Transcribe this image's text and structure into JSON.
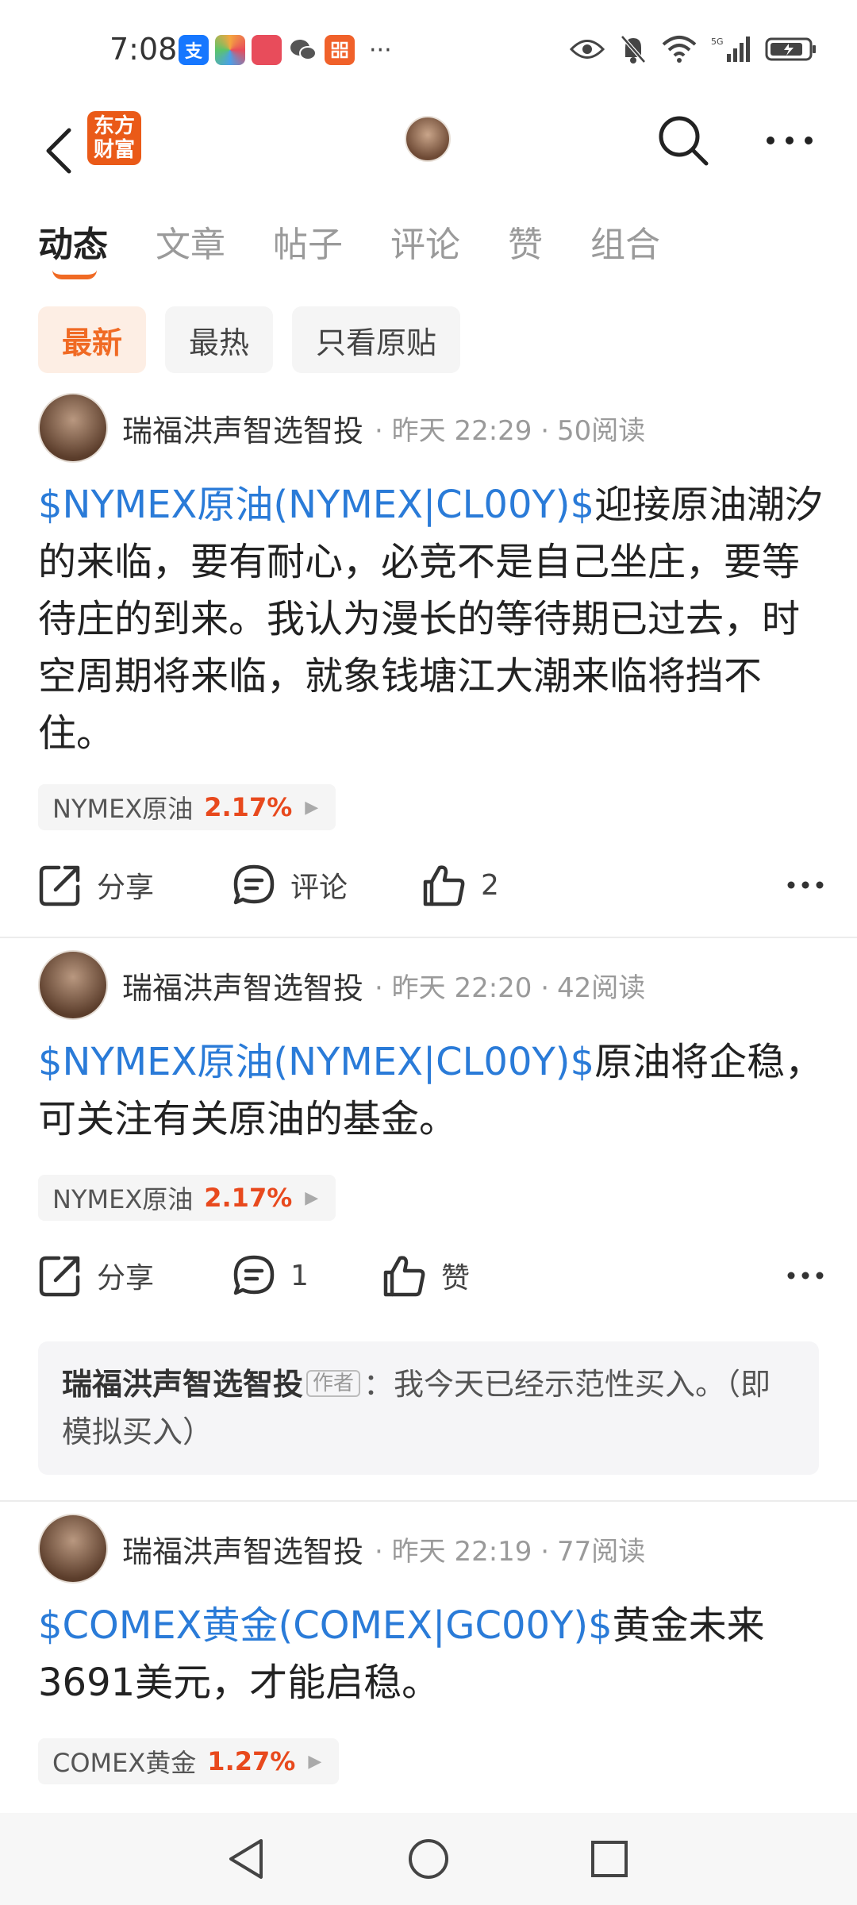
{
  "status_bar": {
    "time": "7:08",
    "apps": [
      {
        "icon": "alipay-icon",
        "glyph": "支",
        "color": "#1677ff"
      },
      {
        "icon": "colorful-app-icon",
        "glyph": "",
        "color": "#f4a640"
      },
      {
        "icon": "huawei-store-icon",
        "glyph": "",
        "color": "#e84c5b"
      },
      {
        "icon": "wechat-icon",
        "glyph": "",
        "color": "#555555"
      },
      {
        "icon": "orange-app-icon",
        "glyph": "",
        "color": "#f0612a"
      }
    ],
    "more": "···"
  },
  "header": {
    "logo_text": "东方财富",
    "logo_color": "#ea5a18"
  },
  "tabs": [
    {
      "label": "动态",
      "active": true
    },
    {
      "label": "文章",
      "active": false
    },
    {
      "label": "帖子",
      "active": false
    },
    {
      "label": "评论",
      "active": false
    },
    {
      "label": "赞",
      "active": false
    },
    {
      "label": "组合",
      "active": false
    }
  ],
  "filters": [
    {
      "label": "最新",
      "active": true
    },
    {
      "label": "最热",
      "active": false
    },
    {
      "label": "只看原贴",
      "active": false
    }
  ],
  "posts": [
    {
      "author": "瑞福洪声智选智投",
      "time": "· 昨天 22:29 ·",
      "reads": "50阅读",
      "stock_link": "$NYMEX原油(NYMEX|CL00Y)$",
      "text": "迎接原油潮汐的来临，要有耐心，必竞不是自己坐庄，要等待庄的到来。我认为漫长的等待期已过去，时空周期将来临，就象钱塘江大潮来临将挡不住。",
      "tag_name": "NYMEX原油",
      "tag_pct": "2.17%",
      "share": "分享",
      "comment": "评论",
      "like": "2"
    },
    {
      "author": "瑞福洪声智选智投",
      "time": "· 昨天 22:20 ·",
      "reads": "42阅读",
      "stock_link": "$NYMEX原油(NYMEX|CL00Y)$",
      "text": "原油将企稳，可关注有关原油的基金。",
      "tag_name": "NYMEX原油",
      "tag_pct": "2.17%",
      "share": "分享",
      "comment": "1",
      "like": "赞",
      "reply": {
        "name": "瑞福洪声智选智投",
        "badge": "作者",
        "text": "：我今天已经示范性买入。（即模拟买入）"
      }
    },
    {
      "author": "瑞福洪声智选智投",
      "time": "· 昨天 22:19 ·",
      "reads": "77阅读",
      "stock_link": "$COMEX黄金(COMEX|GC00Y)$",
      "text": "黄金未来3691美元，才能启稳。",
      "tag_name": "COMEX黄金",
      "tag_pct": "1.27%"
    }
  ],
  "accent_color": "#f06a24",
  "link_color": "#2a7bd8",
  "up_color": "#e8491d"
}
